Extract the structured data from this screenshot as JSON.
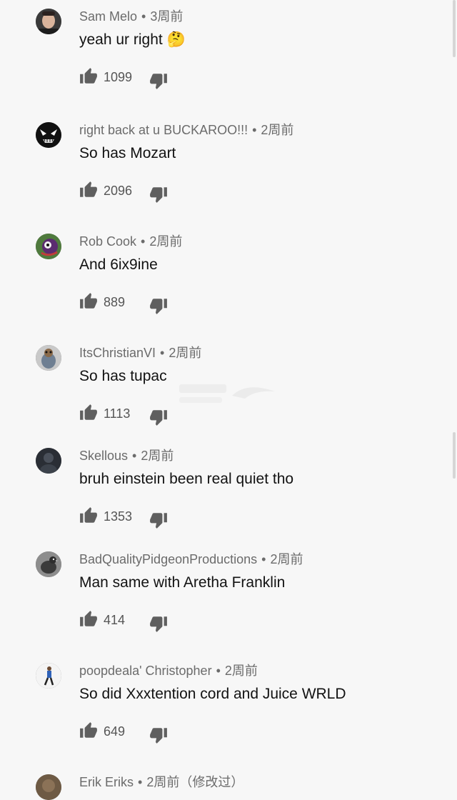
{
  "comments": [
    {
      "author": "Sam Melo",
      "time": "3周前",
      "text": "yeah ur right 🤔",
      "likes": "1099",
      "avatar_icon": "elon-face-avatar"
    },
    {
      "author": "right back at u BUCKAROO!!!",
      "time": "2周前",
      "text": "So has Mozart",
      "likes": "2096",
      "avatar_icon": "venom-avatar"
    },
    {
      "author": "Rob Cook",
      "time": "2周前",
      "text": "And 6ix9ine",
      "likes": "889",
      "avatar_icon": "colorful-character-avatar"
    },
    {
      "author": "ItsChristianVI",
      "time": "2周前",
      "text": "So has tupac",
      "likes": "1113",
      "avatar_icon": "cartoon-bird-avatar"
    },
    {
      "author": "Skellous",
      "time": "2周前",
      "text": "bruh einstein been real quiet tho",
      "likes": "1353",
      "avatar_icon": "dark-figure-avatar"
    },
    {
      "author": "BadQualityPidgeonProductions",
      "time": "2周前",
      "text": "Man same with Aretha Franklin",
      "likes": "414",
      "avatar_icon": "pigeon-avatar"
    },
    {
      "author": "poopdeala' Christopher",
      "time": "2周前",
      "text": "So did Xxxtention cord and Juice WRLD",
      "likes": "649",
      "avatar_icon": "running-person-avatar"
    },
    {
      "author": "Erik Eriks",
      "time": "2周前（修改过）",
      "text": "",
      "likes": "",
      "avatar_icon": "brown-avatar"
    }
  ],
  "icons": {
    "like": "thumbs-up-icon",
    "dislike": "thumbs-down-icon"
  },
  "colors": {
    "background": "#f7f7f7",
    "meta_text": "#6b6b6b",
    "comment_text": "#121212",
    "icon": "#5f5f5f"
  }
}
